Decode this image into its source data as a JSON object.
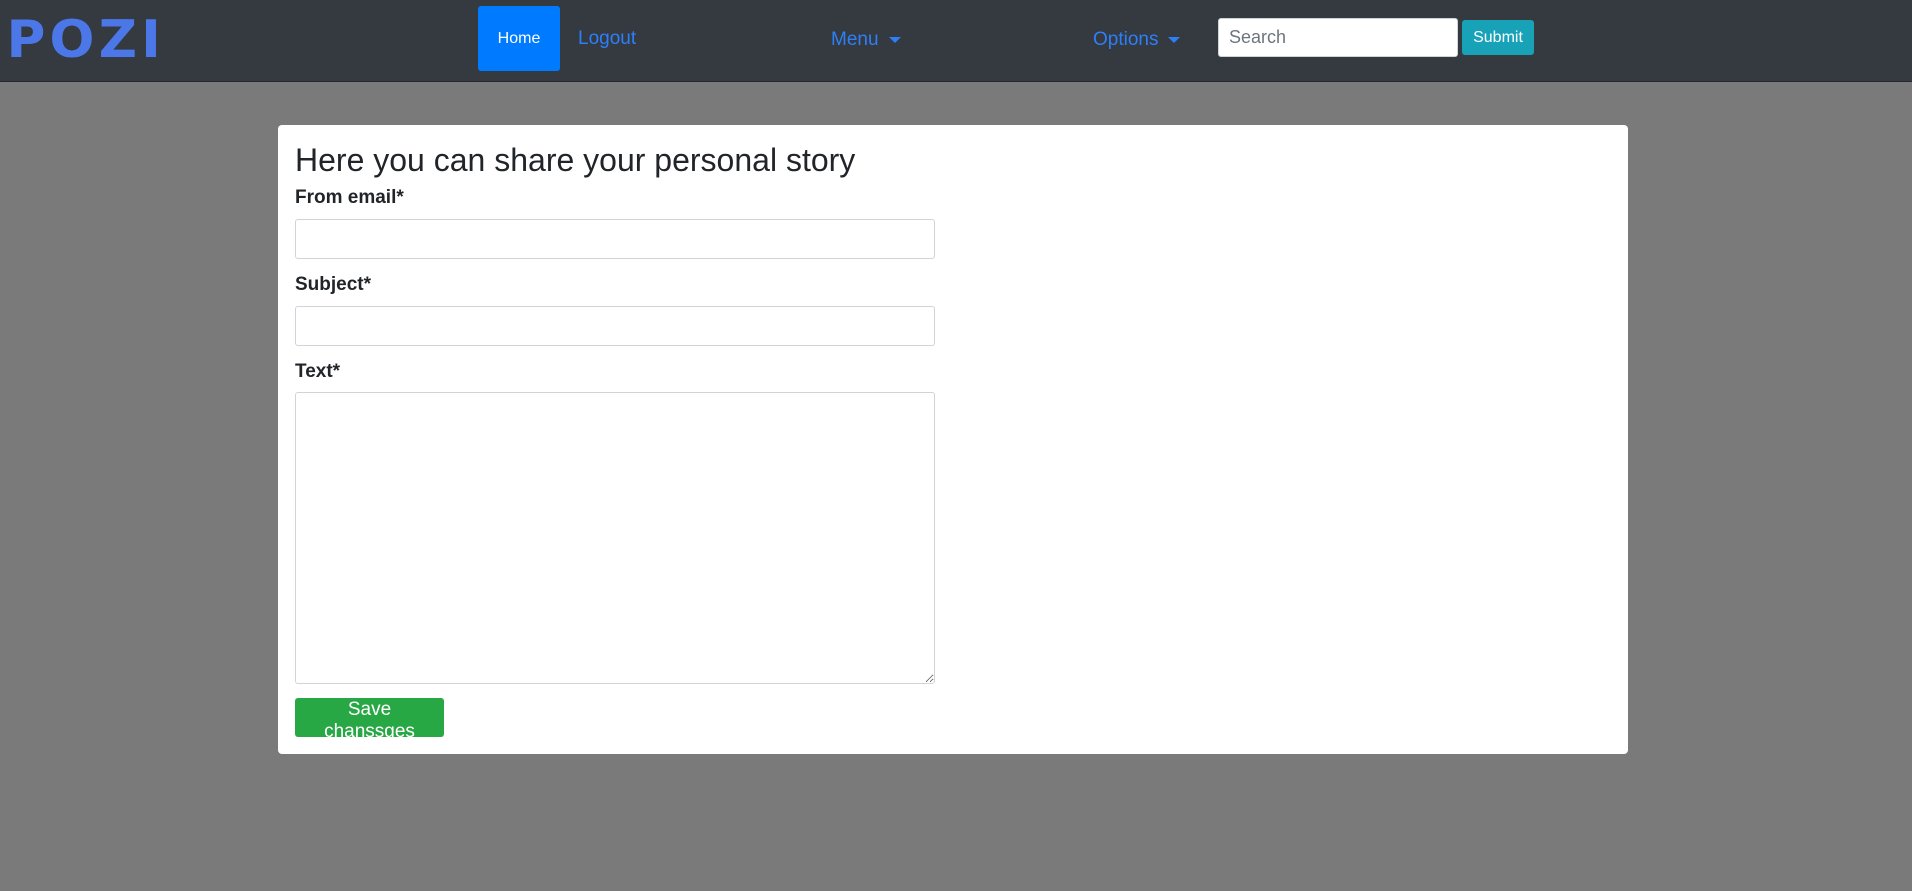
{
  "navbar": {
    "brand": "POZI",
    "home_label": "Home",
    "logout_label": "Logout",
    "menu_label": "Menu",
    "options_label": "Options",
    "search_placeholder": "Search",
    "search_value": "",
    "submit_label": "Submit"
  },
  "form": {
    "title": "Here you can share your personal story",
    "email_label": "From email*",
    "email_value": "",
    "subject_label": "Subject*",
    "subject_value": "",
    "text_label": "Text*",
    "text_value": "",
    "save_label": "Save chanssges"
  },
  "colors": {
    "navbar_bg": "#343a40",
    "page_bg": "#7a7a7a",
    "brand": "#4b77e8",
    "link": "#2d7ff9",
    "primary": "#007bff",
    "info": "#17a2b8",
    "success": "#28a745"
  },
  "icons": {
    "menu_caret": "caret-down-icon",
    "options_caret": "caret-down-icon"
  }
}
